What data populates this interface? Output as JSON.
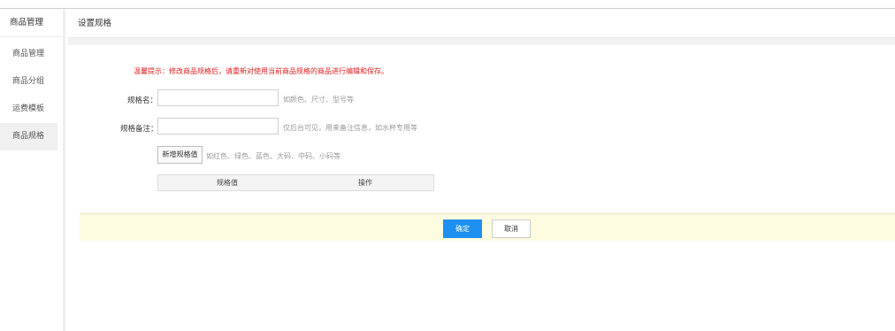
{
  "sidebar": {
    "title": "商品管理",
    "items": [
      {
        "label": "商品管理",
        "active": false
      },
      {
        "label": "商品分组",
        "active": false
      },
      {
        "label": "运费模板",
        "active": false
      },
      {
        "label": "商品规格",
        "active": true
      }
    ]
  },
  "header": {
    "title": "设置规格"
  },
  "form": {
    "warning": "温馨提示：修改商品规格后，请重新对使用当前商品规格的商品进行编辑和保存。",
    "spec_name_label": "规格名：",
    "spec_name_value": "",
    "spec_name_hint": "如颜色、尺寸、型号等",
    "spec_note_label": "规格备注：",
    "spec_note_value": "",
    "spec_note_hint": "仅后台可见，用来备注信息，如水杯专用等",
    "add_value_button": "新增规格值",
    "add_value_hint": "如红色、绿色、蓝色、大码、中码、小码等",
    "table_headers": [
      "规格值",
      "操作"
    ]
  },
  "footer": {
    "confirm_label": "确定",
    "cancel_label": "取消"
  },
  "colors": {
    "accent": "#1e90f0",
    "warning": "#e02020",
    "footer_bg": "#fdfbe0"
  }
}
